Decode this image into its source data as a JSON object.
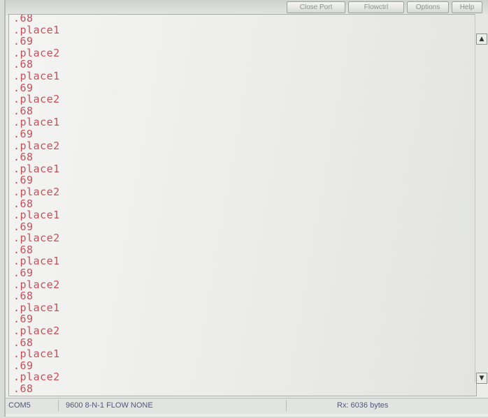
{
  "toolbar": {
    "buttons": [
      "Close Port",
      "Flowctrl",
      "Options",
      "Help"
    ]
  },
  "terminal": {
    "lines": [
      ".68",
      ".place1",
      ".69",
      ".place2",
      ".68",
      ".place1",
      ".69",
      ".place2",
      ".68",
      ".place1",
      ".69",
      ".place2",
      ".68",
      ".place1",
      ".69",
      ".place2",
      ".68",
      ".place1",
      ".69",
      ".place2",
      ".68",
      ".place1",
      ".69",
      ".place2",
      ".68",
      ".place1",
      ".69",
      ".place2",
      ".68",
      ".place1",
      ".69",
      ".place2",
      ".68",
      "."
    ],
    "text_color": "#c6505a"
  },
  "statusbar": {
    "port": "COM5",
    "settings": "9600 8-N-1  FLOW NONE",
    "rx": "Rx: 6036 bytes"
  },
  "icons": {
    "scroll_up": "chevron-up-icon",
    "scroll_down": "chevron-down-icon"
  }
}
